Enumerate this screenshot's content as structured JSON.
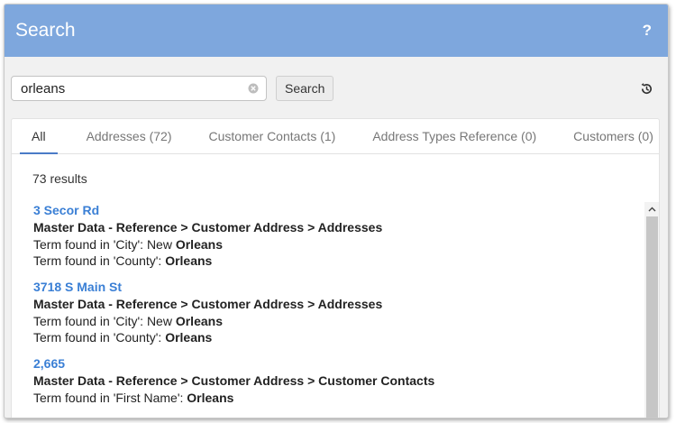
{
  "window": {
    "title": "Search",
    "help_label": "?"
  },
  "search": {
    "value": "orleans",
    "button_label": "Search"
  },
  "tabs": [
    {
      "label": "All",
      "active": true
    },
    {
      "label": "Addresses (72)",
      "active": false
    },
    {
      "label": "Customer Contacts (1)",
      "active": false
    },
    {
      "label": "Address Types Reference (0)",
      "active": false
    },
    {
      "label": "Customers (0)",
      "active": false
    }
  ],
  "results_count": "73 results",
  "results": [
    {
      "title": "3 Secor Rd",
      "path": "Master Data - Reference > Customer Address > Addresses",
      "lines": [
        {
          "prefix": "Term found in 'City': New ",
          "match": "Orleans"
        },
        {
          "prefix": "Term found in 'County': ",
          "match": "Orleans"
        }
      ]
    },
    {
      "title": "3718 S Main St",
      "path": "Master Data - Reference > Customer Address > Addresses",
      "lines": [
        {
          "prefix": "Term found in 'City': New ",
          "match": "Orleans"
        },
        {
          "prefix": "Term found in 'County': ",
          "match": "Orleans"
        }
      ]
    },
    {
      "title": "2,665",
      "path": "Master Data - Reference > Customer Address > Customer Contacts",
      "lines": [
        {
          "prefix": "Term found in 'First Name': ",
          "match": "Orleans"
        }
      ]
    }
  ],
  "colors": {
    "titlebar": "#7ea7dd",
    "link": "#3a7fd5",
    "active_tab_underline": "#4a7bc7"
  },
  "icons": {
    "clear": "clear-circle-icon",
    "history": "history-icon",
    "scroll_up": "chevron-up-icon"
  }
}
